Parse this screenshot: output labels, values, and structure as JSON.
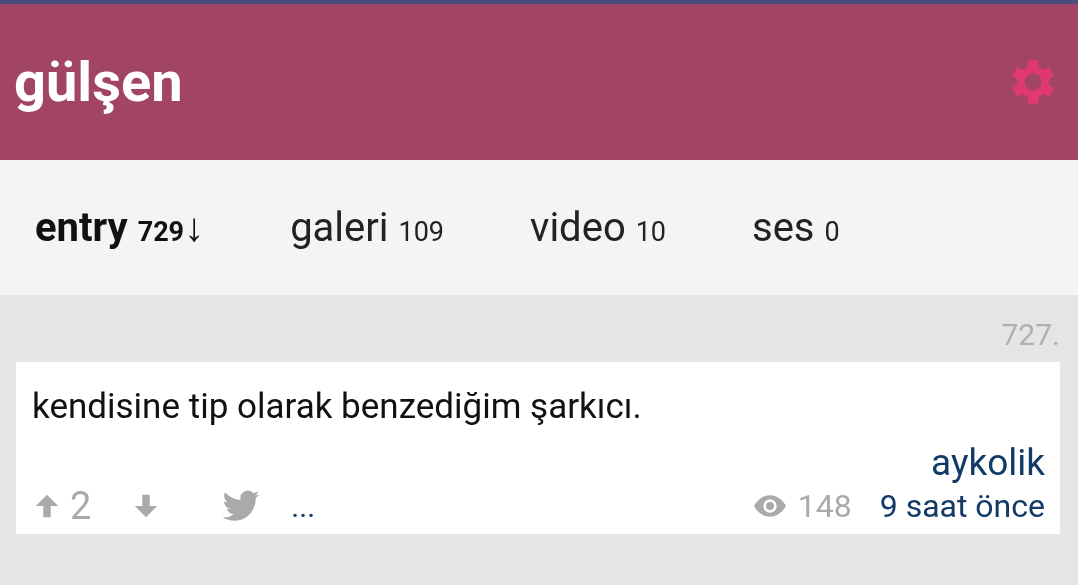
{
  "header": {
    "title": "gülşen"
  },
  "tabs": [
    {
      "label": "entry",
      "count": "729",
      "sort": "↓",
      "selected": true
    },
    {
      "label": "galeri",
      "count": "109",
      "selected": false
    },
    {
      "label": "video",
      "count": "10",
      "selected": false
    },
    {
      "label": "ses",
      "count": "0",
      "selected": false
    }
  ],
  "entries": [
    {
      "number": "727.",
      "text": "kendisine tip olarak benzediğim şarkıcı.",
      "author": "aykolik",
      "upvotes": "2",
      "more": "...",
      "views": "148",
      "time": "9 saat önce"
    }
  ]
}
